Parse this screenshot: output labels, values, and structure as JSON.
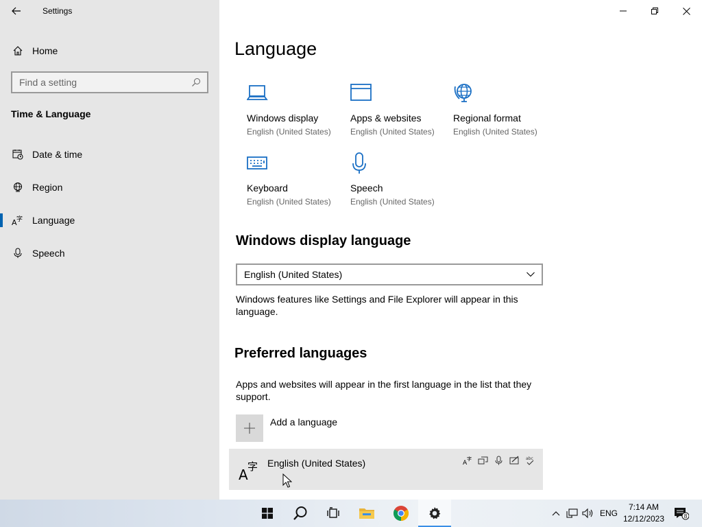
{
  "window": {
    "title": "Settings",
    "controls": [
      "minimize",
      "restore",
      "close"
    ]
  },
  "sidebar": {
    "home_label": "Home",
    "search_placeholder": "Find a setting",
    "section_title": "Time & Language",
    "items": [
      {
        "label": "Date & time",
        "icon": "calendar-clock-icon"
      },
      {
        "label": "Region",
        "icon": "globe-icon"
      },
      {
        "label": "Language",
        "icon": "language-icon",
        "active": true
      },
      {
        "label": "Speech",
        "icon": "microphone-icon"
      }
    ]
  },
  "main": {
    "title": "Language",
    "tiles": [
      {
        "name": "Windows display",
        "sub": "English (United States)",
        "icon": "laptop-icon"
      },
      {
        "name": "Apps & websites",
        "sub": "English (United States)",
        "icon": "window-icon"
      },
      {
        "name": "Regional format",
        "sub": "English (United States)",
        "icon": "globe-icon"
      },
      {
        "name": "Keyboard",
        "sub": "English (United States)",
        "icon": "keyboard-icon"
      },
      {
        "name": "Speech",
        "sub": "English (United States)",
        "icon": "microphone-icon"
      }
    ],
    "display_language": {
      "heading": "Windows display language",
      "selected": "English (United States)",
      "description": "Windows features like Settings and File Explorer will appear in this language."
    },
    "preferred": {
      "heading": "Preferred languages",
      "description": "Apps and websites will appear in the first language in the list that they support.",
      "add_label": "Add a language",
      "languages": [
        {
          "name": "English (United States)"
        }
      ]
    }
  },
  "taskbar": {
    "apps": [
      "start",
      "search",
      "task-view",
      "file-explorer",
      "chrome",
      "settings"
    ],
    "tray": {
      "input_lang": "ENG",
      "time": "7:14 AM",
      "date": "12/12/2023",
      "notifications": "8"
    }
  },
  "colors": {
    "accent": "#0063b1",
    "sidebar_bg": "#e6e6e6",
    "icon_blue": "#1a6fc4"
  }
}
